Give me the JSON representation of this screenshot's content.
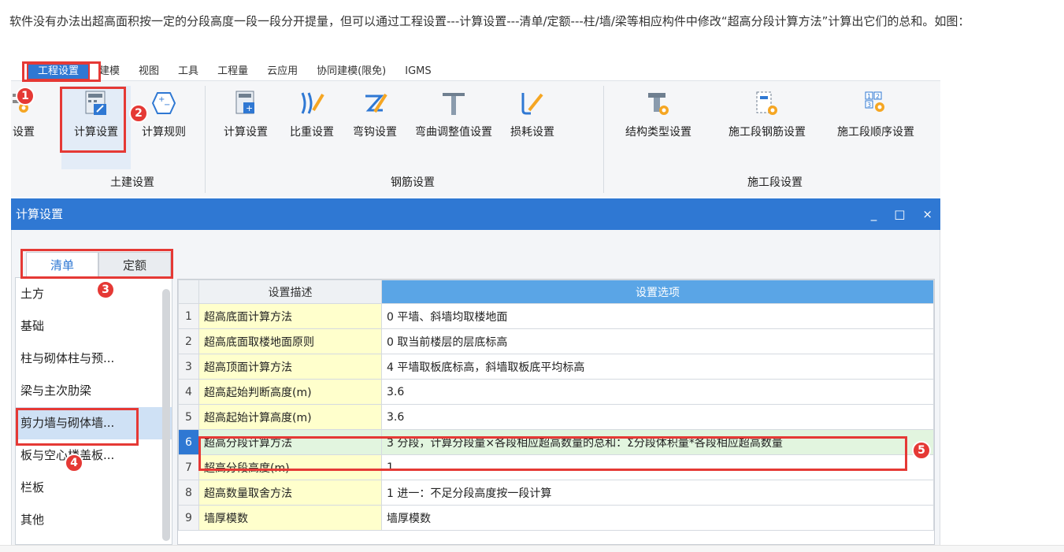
{
  "intro": "软件没有办法出超高面积按一定的分段高度一段一段分开提量，但可以通过工程设置---计算设置---清单/定额---柱/墙/梁等相应构件中修改“超高分段计算方法”计算出它们的总和。如图：",
  "ribbon": {
    "tabs": [
      "工程设置",
      "建模",
      "视图",
      "工具",
      "工程量",
      "云应用",
      "协同建模(限免)",
      "IGMS"
    ],
    "buttons": {
      "partial": "设置",
      "calc_settings": "计算设置",
      "calc_rules": "计算规则",
      "rebar_calc": "计算设置",
      "density": "比重设置",
      "hook": "弯钩设置",
      "bend_adjust": "弯曲调整值设置",
      "loss": "损耗设置",
      "struct_type": "结构类型设置",
      "stage_rebar": "施工段钢筋设置",
      "stage_order": "施工段顺序设置"
    },
    "groups": {
      "civil": "土建设置",
      "rebar": "钢筋设置",
      "stage": "施工段设置"
    }
  },
  "window": {
    "title": "计算设置",
    "minimize": "_",
    "maximize": "□",
    "close": "×"
  },
  "tabs": {
    "qingdan": "清单",
    "dinge": "定额"
  },
  "left_items": [
    "土方",
    "基础",
    "柱与砌体柱与预...",
    "梁与主次肋梁",
    "剪力墙与砌体墙...",
    "板与空心楼盖板...",
    "栏板",
    "其他"
  ],
  "grid": {
    "headers": [
      "设置描述",
      "设置选项"
    ],
    "rows": [
      {
        "num": "1",
        "desc": "超高底面计算方法",
        "val": "0 平墙、斜墙均取楼地面"
      },
      {
        "num": "2",
        "desc": "超高底面取楼地面原则",
        "val": "0 取当前楼层的层底标高"
      },
      {
        "num": "3",
        "desc": "超高顶面计算方法",
        "val": "4 平墙取板底标高，斜墙取板底平均标高"
      },
      {
        "num": "4",
        "desc": "超高起始判断高度(m)",
        "val": "3.6"
      },
      {
        "num": "5",
        "desc": "超高起始计算高度(m)",
        "val": "3.6"
      },
      {
        "num": "6",
        "desc": "超高分段计算方法",
        "val": "3 分段，计算分段量×各段相应超高数量的总和：Σ分段体积量*各段相应超高数量"
      },
      {
        "num": "7",
        "desc": "超高分段高度(m)",
        "val": "1"
      },
      {
        "num": "8",
        "desc": "超高数量取舍方法",
        "val": "1 进一：不足分段高度按一段计算"
      },
      {
        "num": "9",
        "desc": "墙厚模数",
        "val": "墙厚模数"
      }
    ]
  },
  "badges": [
    "1",
    "2",
    "3",
    "4",
    "5"
  ],
  "colors": {
    "accent": "#2f78d3",
    "highlight": "#e53935",
    "desc_bg": "#ffffcc",
    "sel_bg": "#e2f5df"
  }
}
